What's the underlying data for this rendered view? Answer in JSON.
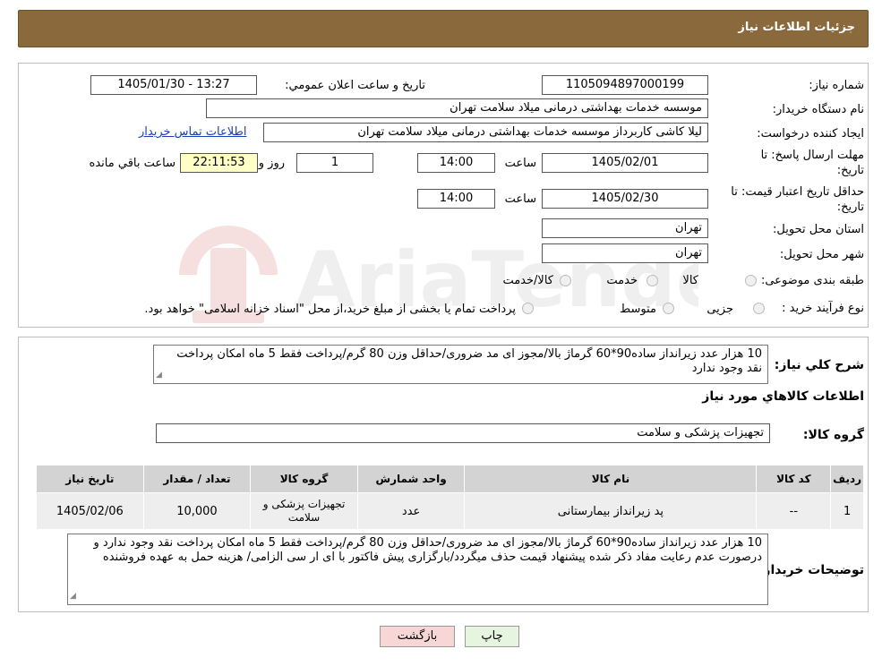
{
  "page": {
    "title": "جزئیات اطلاعات نیاز"
  },
  "form": {
    "need_number_label": "شماره نیاز:",
    "need_number": "1105094897000199",
    "announce_label": "تاریخ و ساعت اعلان عمومي:",
    "announce_value": "1405/01/30 - 13:27",
    "buyer_org_label": "نام دستگاه خريدار:",
    "buyer_org": "موسسه خدمات بهداشتی درمانی میلاد سلامت تهران",
    "creator_label": "ایجاد کننده درخواست:",
    "creator": "لیلا کاشی کاربرداز موسسه خدمات بهداشتی درمانی میلاد سلامت تهران",
    "contact_link": "اطلاعات تماس خریدار",
    "reply_deadline_label_1": "مهلت ارسال پاسخ: تا",
    "reply_deadline_label_2": "تاریخ:",
    "reply_date": "1405/02/01",
    "time_label": "ساعت",
    "reply_time": "14:00",
    "days_value": "1",
    "days_label": "روز و",
    "remaining_time": "22:11:53",
    "remaining_label": "ساعت باقي مانده",
    "price_validity_label_1": "حداقل تاریخ اعتبار قیمت: تا",
    "price_validity_label_2": "تاریخ:",
    "price_date": "1405/02/30",
    "price_time": "14:00",
    "province_label": "استان محل تحویل:",
    "province": "تهران",
    "city_label": "شهر محل تحویل:",
    "city": "تهران",
    "category_label": "طبقه بندی موضوعی:",
    "category_options": [
      "کالا",
      "خدمت",
      "کالا/خدمت"
    ],
    "process_label": "نوع فرآیند خرید :",
    "process_options": [
      "جزیی",
      "متوسط"
    ],
    "process_note": "پرداخت تمام یا بخشی از مبلغ خرید،از محل \"اسناد خزانه اسلامی\" خواهد بود."
  },
  "summary": {
    "label": "شرح کلي نياز:",
    "text": "10 هزار عدد زیرانداز ساده90*60 گرماژ بالا/مجوز ای مد ضروری/حداقل وزن 80 گرم/پرداخت فقط 5 ماه امکان پرداخت نقد وجود ندارد"
  },
  "goods": {
    "section_title": "اطلاعات کالاهاي مورد نياز",
    "group_label": "گروه کالا:",
    "group_value": "تجهیزات پزشکی و سلامت"
  },
  "table": {
    "headers": [
      "رديف",
      "کد کالا",
      "نام کالا",
      "واحد شمارش",
      "گروه کالا",
      "تعداد / مقدار",
      "تاریخ نیاز"
    ],
    "rows": [
      [
        "1",
        "--",
        "پد زیرانداز بیمارستانی",
        "عدد",
        "تجهیزات پزشکی و سلامت",
        "10,000",
        "1405/02/06"
      ]
    ]
  },
  "buyer_notes": {
    "label": "توضیحات خریدار:",
    "text": "10 هزار عدد زیرانداز ساده90*60 گرماژ بالا/مجوز ای مد ضروری/حداقل وزن 80 گرم/پرداخت فقط 5 ماه امکان پرداخت نقد وجود ندارد و درصورت عدم رعایت مفاد ذکر شده پیشنهاد قیمت حذف میگردد/بارگزاری پیش فاکتور با ای ار سی الزامی/ هزینه حمل به عهده فروشنده"
  },
  "buttons": {
    "print": "چاپ",
    "back": "بازگشت"
  },
  "colors": {
    "header": "#8a6a3c",
    "table_header": "#d3d3d3",
    "back_button": "#f9d6d6",
    "print_button": "#e6f5e0",
    "highlight": "#ffffc6"
  }
}
